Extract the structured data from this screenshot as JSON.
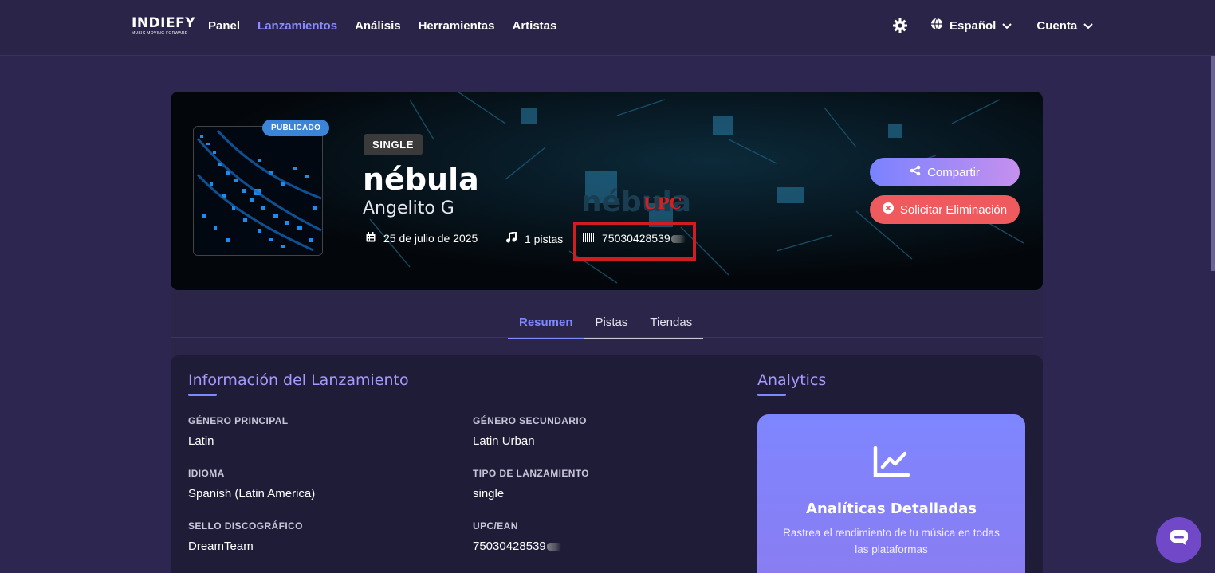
{
  "nav": {
    "logo_main": "INDIEFY",
    "logo_sub": "MUSIC MOVING FORWARD",
    "links": [
      "Panel",
      "Lanzamientos",
      "Análisis",
      "Herramientas",
      "Artistas"
    ],
    "active_link": "Lanzamientos",
    "language": "Español",
    "account": "Cuenta"
  },
  "release": {
    "status_badge": "PUBLICADO",
    "type_badge": "SINGLE",
    "title": "nébula",
    "artist": "Angelito G",
    "date": "25 de julio de 2025",
    "tracks": "1 pistas",
    "upc": "75030428539",
    "upc_annotation": "UPC"
  },
  "actions": {
    "share": "Compartir",
    "request_removal": "Solicitar Eliminación"
  },
  "tabs": [
    "Resumen",
    "Pistas",
    "Tiendas"
  ],
  "active_tab": "Resumen",
  "info": {
    "section_title": "Información del Lanzamiento",
    "fields": {
      "primary_genre": {
        "label": "GÉNERO PRINCIPAL",
        "value": "Latin"
      },
      "secondary_genre": {
        "label": "GÉNERO SECUNDARIO",
        "value": "Latin Urban"
      },
      "language": {
        "label": "IDIOMA",
        "value": "Spanish (Latin America)"
      },
      "release_type": {
        "label": "TIPO DE LANZAMIENTO",
        "value": "single"
      },
      "label": {
        "label": "SELLO DISCOGRÁFICO",
        "value": "DreamTeam"
      },
      "upc_ean": {
        "label": "UPC/EAN",
        "value": "75030428539"
      }
    }
  },
  "analytics": {
    "section_title": "Analytics",
    "card_title": "Analíticas Detalladas",
    "card_desc": "Rastrea el rendimiento de tu música en todas las plataformas"
  },
  "colors": {
    "accent": "#7e88ff",
    "published": "#3b84d8",
    "danger": "#ee5a5e",
    "annotation_red": "#d01d22"
  },
  "icons": [
    "settings-gear-icon",
    "globe-icon",
    "chevron-down-icon",
    "calendar-icon",
    "music-note-icon",
    "barcode-icon",
    "share-icon",
    "close-circle-icon",
    "chart-line-icon",
    "chat-bubble-icon"
  ]
}
